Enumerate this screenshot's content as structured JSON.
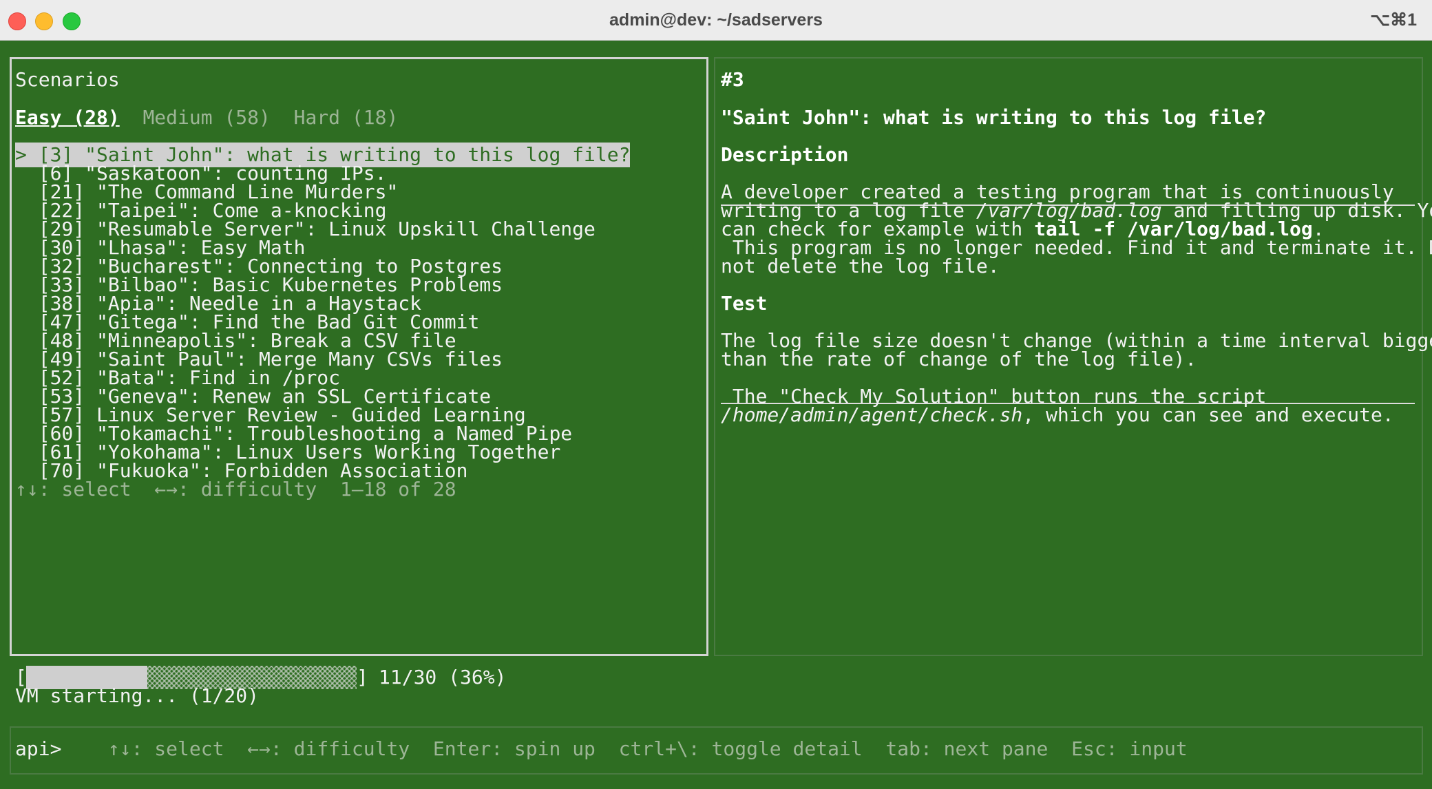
{
  "window": {
    "title": "admin@dev: ~/sadservers",
    "shortcut": "⌥⌘1"
  },
  "left_pane": {
    "title": "Scenarios",
    "tabs": [
      {
        "label": "Easy (28)",
        "active": true
      },
      {
        "label": "Medium (58)",
        "active": false
      },
      {
        "label": "Hard (18)",
        "active": false
      }
    ],
    "selected_marker": ">",
    "items": [
      {
        "label": "[3] \"Saint John\": what is writing to this log file?",
        "selected": true
      },
      {
        "label": "[6] \"Saskatoon\": counting IPs."
      },
      {
        "label": "[21] \"The Command Line Murders\""
      },
      {
        "label": "[22] \"Taipei\": Come a-knocking"
      },
      {
        "label": "[29] \"Resumable Server\": Linux Upskill Challenge"
      },
      {
        "label": "[30] \"Lhasa\": Easy Math"
      },
      {
        "label": "[32] \"Bucharest\": Connecting to Postgres"
      },
      {
        "label": "[33] \"Bilbao\": Basic Kubernetes Problems"
      },
      {
        "label": "[38] \"Apia\": Needle in a Haystack"
      },
      {
        "label": "[47] \"Gitega\": Find the Bad Git Commit"
      },
      {
        "label": "[48] \"Minneapolis\": Break a CSV file"
      },
      {
        "label": "[49] \"Saint Paul\": Merge Many CSVs files"
      },
      {
        "label": "[52] \"Bata\": Find in /proc"
      },
      {
        "label": "[53] \"Geneva\": Renew an SSL Certificate"
      },
      {
        "label": "[57] Linux Server Review - Guided Learning"
      },
      {
        "label": "[60] \"Tokamachi\": Troubleshooting a Named Pipe"
      },
      {
        "label": "[61] \"Yokohama\": Linux Users Working Together"
      },
      {
        "label": "[70] \"Fukuoka\": Forbidden Association"
      }
    ],
    "footer": "↑↓: select  ←→: difficulty  1–18 of 28"
  },
  "detail": {
    "number": "#3",
    "title": "\"Saint John\": what is writing to this log file?",
    "description_heading": "Description",
    "description": {
      "line1": "A developer created a testing program that is continuously",
      "line2_a": "writing to a log file ",
      "line2_path": "/var/log/bad.log",
      "line2_b": " and filling up disk. You",
      "line3_a": "can check for example with ",
      "line3_cmd": "tail -f /var/log/bad.log",
      "line3_b": ".",
      "line4": " This program is no longer needed. Find it and terminate it. Do",
      "line5": "not delete the log file."
    },
    "test_heading": "Test",
    "test": {
      "line1": "The log file size doesn't change (within a time interval bigger",
      "line2": "than the rate of change of the log file).",
      "line3": " The \"Check My Solution\" button runs the script",
      "line4_path": "/home/admin/agent/check.sh",
      "line4_b": ", which you can see and execute."
    }
  },
  "progress": {
    "value": 0.367,
    "open_bracket": "[",
    "close_bracket": "]",
    "text": "11/30 (36%)",
    "status": "VM starting... (1/20)"
  },
  "input": {
    "prompt": "api>",
    "hints": [
      "↑↓: select",
      "←→: difficulty",
      "Enter: spin up",
      "ctrl+\\: toggle detail",
      "tab: next pane",
      "Esc: input"
    ]
  },
  "colors": {
    "background": "#2e6d22",
    "highlight": "#d0d0d0",
    "dim_text": "#9db596"
  }
}
